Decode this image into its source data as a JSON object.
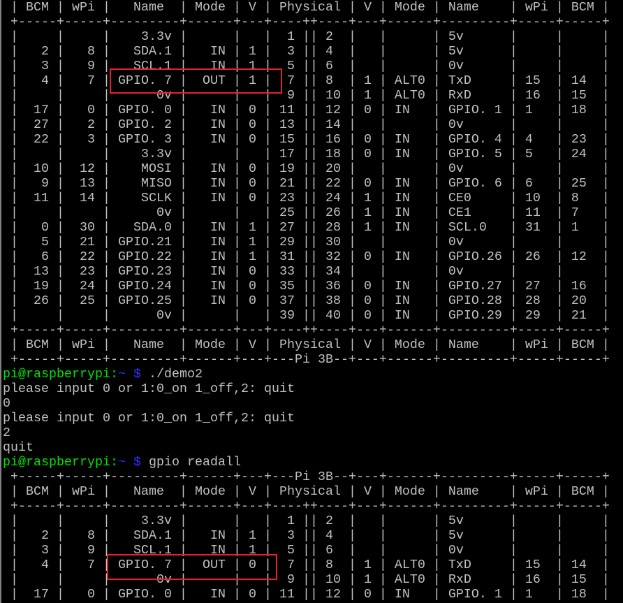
{
  "colors": {
    "background": "#000000",
    "text": "#c0c0c0",
    "prompt_user": "#00e000",
    "prompt_path": "#3030ff",
    "highlight": "#e8202a"
  },
  "terminal": {
    "lines": [
      " | BCM | wPi |   Name  | Mode | V | Physical | V | Mode | Name    | wPi | BCM |",
      " +-----+-----+---------+------+---+----++----+---+------+---------+-----+-----+",
      " |     |     |    3.3v |      |   |  1 || 2  |   |      | 5v      |     |     |",
      " |   2 |   8 |   SDA.1 |   IN | 1 |  3 || 4  |   |      | 5v      |     |     |",
      " |   3 |   9 |   SCL.1 |   IN | 1 |  5 || 6  |   |      | 0v      |     |     |",
      " |   4 |   7 | GPIO. 7 |  OUT | 1 |  7 || 8  | 1 | ALT0 | TxD     | 15  | 14  |",
      " |     |     |      0v |      |   |  9 || 10 | 1 | ALT0 | RxD     | 16  | 15  |",
      " |  17 |   0 | GPIO. 0 |   IN | 0 | 11 || 12 | 0 | IN   | GPIO. 1 | 1   | 18  |",
      " |  27 |   2 | GPIO. 2 |   IN | 0 | 13 || 14 |   |      | 0v      |     |     |",
      " |  22 |   3 | GPIO. 3 |   IN | 0 | 15 || 16 | 0 | IN   | GPIO. 4 | 4   | 23  |",
      " |     |     |    3.3v |      |   | 17 || 18 | 0 | IN   | GPIO. 5 | 5   | 24  |",
      " |  10 |  12 |    MOSI |   IN | 0 | 19 || 20 |   |      | 0v      |     |     |",
      " |   9 |  13 |    MISO |   IN | 0 | 21 || 22 | 0 | IN   | GPIO. 6 | 6   | 25  |",
      " |  11 |  14 |    SCLK |   IN | 0 | 23 || 24 | 1 | IN   | CE0     | 10  | 8   |",
      " |     |     |      0v |      |   | 25 || 26 | 1 | IN   | CE1     | 11  | 7   |",
      " |   0 |  30 |   SDA.0 |   IN | 1 | 27 || 28 | 1 | IN   | SCL.0   | 31  | 1   |",
      " |   5 |  21 | GPIO.21 |   IN | 1 | 29 || 30 |   |      | 0v      |     |     |",
      " |   6 |  22 | GPIO.22 |   IN | 1 | 31 || 32 | 0 | IN   | GPIO.26 | 26  | 12  |",
      " |  13 |  23 | GPIO.23 |   IN | 0 | 33 || 34 |   |      | 0v      |     |     |",
      " |  19 |  24 | GPIO.24 |   IN | 0 | 35 || 36 | 0 | IN   | GPIO.27 | 27  | 16  |",
      " |  26 |  25 | GPIO.25 |   IN | 0 | 37 || 38 | 0 | IN   | GPIO.28 | 28  | 20  |",
      " |     |     |      0v |      |   | 39 || 40 | 0 | IN   | GPIO.29 | 29  | 21  |",
      " +-----+-----+---------+------+---+----++----+---+------+---------+-----+-----+",
      " | BCM | wPi |   Name  | Mode | V | Physical | V | Mode | Name    | wPi | BCM |",
      " +-----+-----+---------+------+---+---Pi 3B--+---+------+---------+-----+-----+",
      {
        "user": "pi@raspberrypi:",
        "path": "~",
        "symbol": " $",
        "command": " ./demo2"
      },
      "please input 0 or 1:0_on 1_off,2: quit",
      "0",
      "please input 0 or 1:0_on 1_off,2: quit",
      "2",
      "quit",
      {
        "user": "pi@raspberrypi:",
        "path": "~",
        "symbol": " $",
        "command": " gpio readall"
      },
      " +-----+-----+---------+------+---+---Pi 3B--+---+------+---------+-----+-----+",
      " | BCM | wPi |   Name  | Mode | V | Physical | V | Mode | Name    | wPi | BCM |",
      " +-----+-----+---------+------+---+----++----+---+------+---------+-----+-----+",
      " |     |     |    3.3v |      |   |  1 || 2  |   |      | 5v      |     |     |",
      " |   2 |   8 |   SDA.1 |   IN | 1 |  3 || 4  |   |      | 5v      |     |     |",
      " |   3 |   9 |   SCL.1 |   IN | 1 |  5 || 6  |   |      | 0v      |     |     |",
      " |   4 |   7 | GPIO. 7 |  OUT | 0 |  7 || 8  | 1 | ALT0 | TxD     | 15  | 14  |",
      " |     |     |      0v |      |   |  9 || 10 | 1 | ALT0 | RxD     | 16  | 15  |",
      " |  17 |   0 | GPIO. 0 |   IN | 0 | 11 || 12 | 0 | IN   | GPIO. 1 | 1   | 18  |"
    ]
  }
}
